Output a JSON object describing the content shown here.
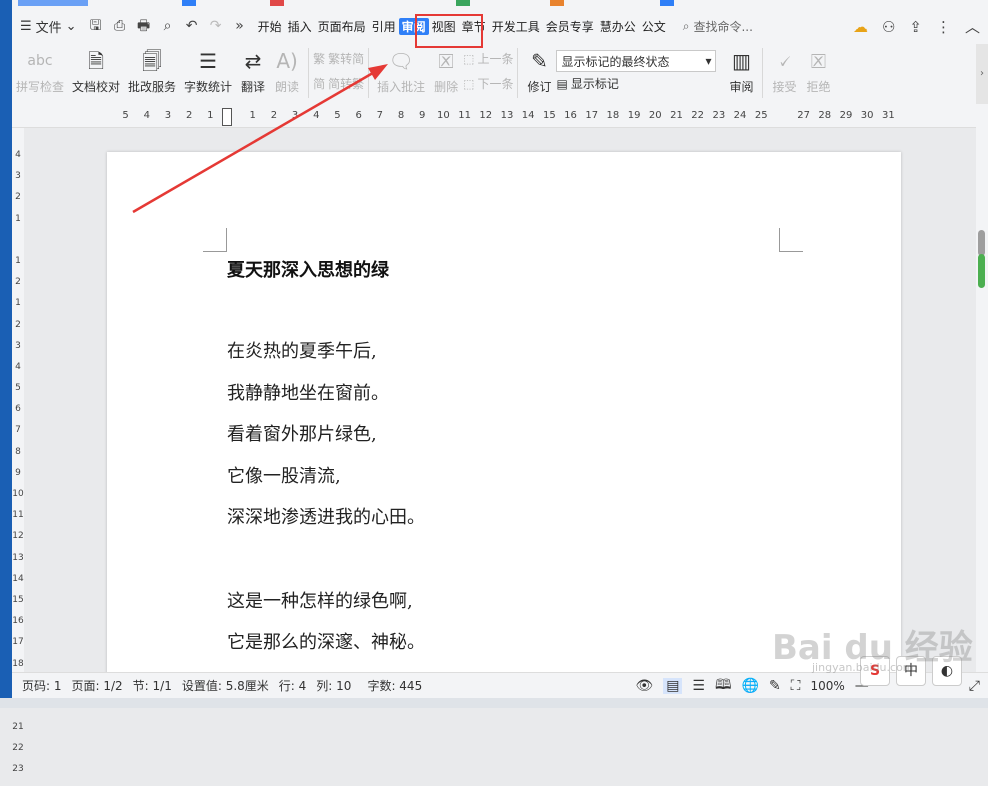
{
  "menubar": {
    "file_label": "文件",
    "tabs": [
      "开始",
      "插入",
      "页面布局",
      "引用",
      "审阅",
      "视图",
      "章节",
      "开发工具",
      "会员专享",
      "慧办公",
      "公文"
    ],
    "active_tab": "审阅",
    "search_placeholder": "查找命令..."
  },
  "ribbon": {
    "spell_check": "拼写检查",
    "doc_proof": "文档校对",
    "revise_service": "批改服务",
    "word_count": "字数统计",
    "translate": "翻译",
    "read_aloud": "朗读",
    "trad_to_simp": "繁转简",
    "simp_to_trad": "简转繁",
    "insert_comment": "插入批注",
    "delete": "删除",
    "prev": "上一条",
    "next": "下一条",
    "track_changes": "修订",
    "show_markup_select": "显示标记的最终状态",
    "show_markup": "显示标记",
    "review": "审阅",
    "accept": "接受",
    "reject": "拒绝"
  },
  "ruler": {
    "numbers": [
      "5",
      "4",
      "3",
      "2",
      "1",
      "",
      "1",
      "2",
      "3",
      "4",
      "5",
      "6",
      "7",
      "8",
      "9",
      "10",
      "11",
      "12",
      "13",
      "14",
      "15",
      "16",
      "17",
      "18",
      "19",
      "20",
      "21",
      "22",
      "23",
      "24",
      "25",
      "",
      "27",
      "28",
      "29",
      "30",
      "31"
    ]
  },
  "vruler": {
    "numbers": [
      "4",
      "3",
      "2",
      "1",
      "",
      "1",
      "2",
      "1",
      "2",
      "3",
      "4",
      "5",
      "6",
      "7",
      "8",
      "9",
      "10",
      "11",
      "12",
      "13",
      "14",
      "15",
      "16",
      "17",
      "18",
      "19",
      "20",
      "21",
      "22",
      "23"
    ]
  },
  "document": {
    "title": "夏天那深入思想的绿",
    "lines": [
      "在炎热的夏季午后,",
      "我静静地坐在窗前。",
      "看着窗外那片绿色,",
      "它像一股清流,",
      "深深地渗透进我的心田。"
    ],
    "lines2": [
      "这是一种怎样的绿色啊,",
      "它是那么的深邃、神秘。"
    ]
  },
  "status": {
    "page_num": "页码: 1",
    "pages": "页面: 1/2",
    "section": "节: 1/1",
    "setting": "设置值: 5.8厘米",
    "row": "行: 4",
    "col": "列: 10",
    "wordcount": "字数: 445",
    "zoom": "100%"
  },
  "ime": {
    "mode": "中"
  },
  "watermark": {
    "text": "Bai du 经验",
    "sub": "jingyan.baidu.com"
  },
  "colors": {
    "accent": "#2f7ff7",
    "annotation_red": "#e53935"
  }
}
